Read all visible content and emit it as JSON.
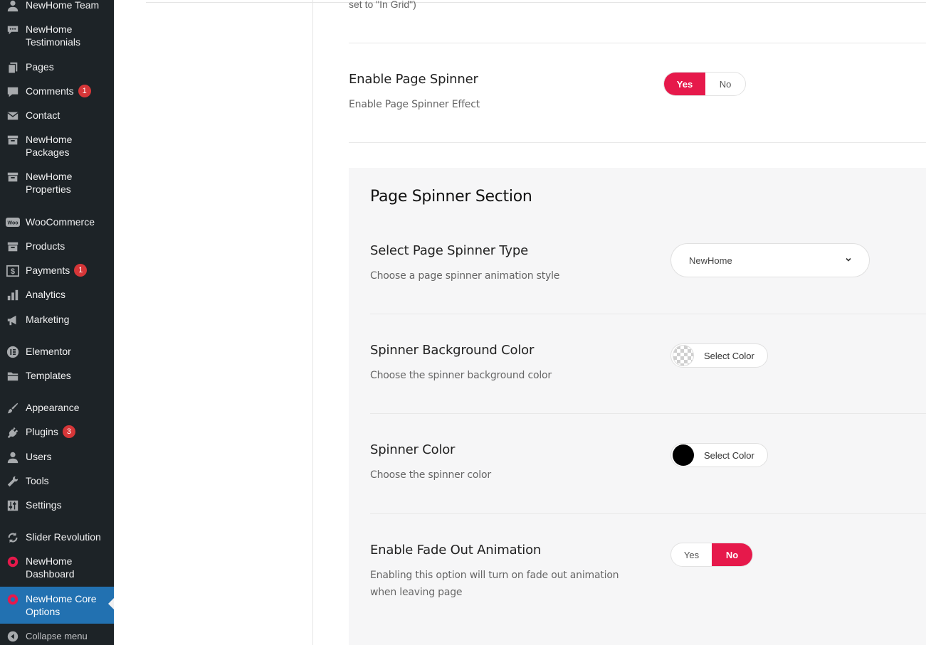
{
  "sidebar": {
    "items": [
      {
        "label": "NewHome Team",
        "icon": "person-icon"
      },
      {
        "label": "NewHome\nTestimonials",
        "icon": "speech-bubble-icon"
      },
      {
        "label": "Pages",
        "icon": "pages-icon"
      },
      {
        "label": "Comments",
        "icon": "comment-icon",
        "badge": "1"
      },
      {
        "label": "Contact",
        "icon": "envelope-icon"
      },
      {
        "label": "NewHome\nPackages",
        "icon": "archive-icon"
      },
      {
        "label": "NewHome\nProperties",
        "icon": "archive-icon"
      },
      {
        "label": "WooCommerce",
        "icon": "woo-icon",
        "icon_text": "Woo"
      },
      {
        "label": "Products",
        "icon": "archive-icon"
      },
      {
        "label": "Payments",
        "icon": "dollar-icon",
        "badge": "1"
      },
      {
        "label": "Analytics",
        "icon": "bar-chart-icon"
      },
      {
        "label": "Marketing",
        "icon": "megaphone-icon"
      },
      {
        "label": "Elementor",
        "icon": "elementor-icon"
      },
      {
        "label": "Templates",
        "icon": "folder-icon"
      },
      {
        "label": "Appearance",
        "icon": "brush-icon"
      },
      {
        "label": "Plugins",
        "icon": "plug-icon",
        "badge": "3"
      },
      {
        "label": "Users",
        "icon": "person-icon"
      },
      {
        "label": "Tools",
        "icon": "wrench-icon"
      },
      {
        "label": "Settings",
        "icon": "sliders-icon"
      },
      {
        "label": "Slider Revolution",
        "icon": "refresh-icon"
      },
      {
        "label": "NewHome\nDashboard",
        "icon": "ring-icon"
      },
      {
        "label": "NewHome Core\nOptions",
        "icon": "ring-icon",
        "current": true
      }
    ],
    "collapse_label": "Collapse menu"
  },
  "main": {
    "truncated_text": "set to \"In Grid\")",
    "page_spinner": {
      "title": "Enable Page Spinner",
      "desc": "Enable Page Spinner Effect",
      "yes": "Yes",
      "no": "No",
      "selected": "Yes"
    },
    "section": {
      "title": "Page Spinner Section",
      "spinner_type": {
        "title": "Select Page Spinner Type",
        "desc": "Choose a page spinner animation style",
        "value": "NewHome"
      },
      "bg_color": {
        "title": "Spinner Background Color",
        "desc": "Choose the spinner background color",
        "button": "Select Color",
        "swatch": "transparent"
      },
      "spinner_color": {
        "title": "Spinner Color",
        "desc": "Choose the spinner color",
        "button": "Select Color",
        "swatch": "#000000"
      },
      "fade_out": {
        "title": "Enable Fade Out Animation",
        "desc": "Enabling this option will turn on fade out animation\nwhen leaving page",
        "yes": "Yes",
        "no": "No",
        "selected": "No"
      }
    }
  },
  "colors": {
    "sidebar_bg": "#1d2327",
    "current_item_bg": "#2271b1",
    "accent": "#e6194b",
    "badge": "#d63638"
  }
}
